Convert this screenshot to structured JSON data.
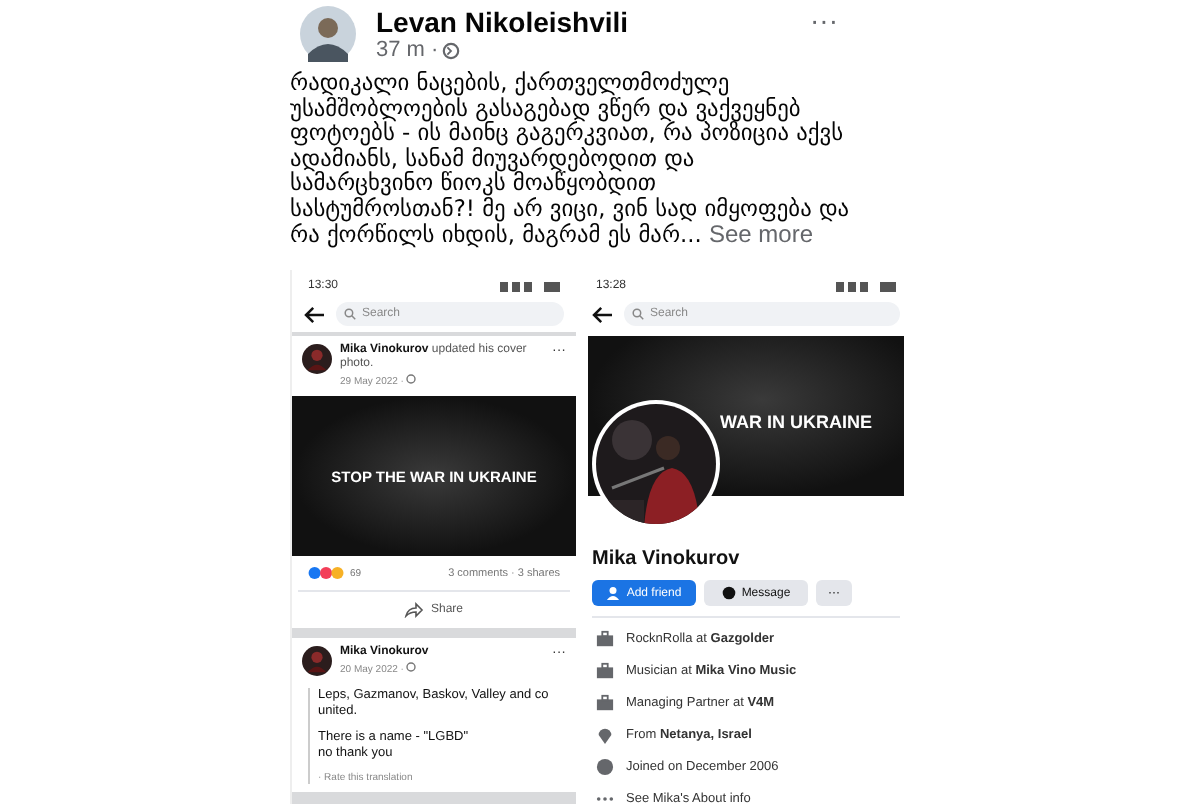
{
  "post": {
    "author": "Levan Nikoleishvili",
    "time": "37 m ·",
    "menu": "···",
    "text": "რადიკალი ნაცების, ქართველთმოძულე უსამშობლოების გასაგებად ვწერ და ვაქვეყნებ ფოტოებს - ის მაინც გაგერკვიათ, რა პოზიცია აქვს ადამიანს, სანამ მიუვარდებოდით და\nსამარცხვინო წიოკს მოაწყობდით\nსასტუმროსთან?! მე არ ვიცი, ვინ სად იმყოფება და რა ქორწილს იხდის, მაგრამ ეს მარ...",
    "see_more": "See more"
  },
  "left_screenshot": {
    "status_time": "13:30",
    "search": {
      "placeholder": "Search"
    },
    "cover_post": {
      "author": "Mika Vinokurov",
      "action": "updated his cover photo.",
      "date": "29 May 2022 ·",
      "menu": "···",
      "banner": "STOP THE WAR IN UKRAINE",
      "reaction_count": "69",
      "stats": "3 comments · 3 shares",
      "share": "Share"
    },
    "text_post": {
      "author": "Mika Vinokurov",
      "date": "20 May 2022 ·",
      "menu": "···",
      "paragraphs": [
        [
          "Leps, Gazmanov, Baskov, Valley and co united."
        ],
        [
          "There is a name - \"LGBD\"",
          "no thank you"
        ]
      ],
      "translate": "· Rate this translation"
    }
  },
  "right_screenshot": {
    "status_time": "13:28",
    "search": {
      "placeholder": "Search"
    },
    "cover_text": "WAR IN UKRAINE",
    "name": "Mika Vinokurov",
    "buttons": [
      {
        "label": "Add friend",
        "kind": "primary"
      },
      {
        "label": "Message",
        "kind": "secondary"
      },
      {
        "label": "···",
        "kind": "more"
      }
    ],
    "details": [
      {
        "kind": "work",
        "text": "RocknRolla at **Gazgolder**"
      },
      {
        "kind": "work",
        "text": "Musician at **Mika Vino Music**"
      },
      {
        "kind": "work",
        "text": "Managing Partner at **V4M**"
      },
      {
        "kind": "location",
        "text": "From **Netanya, Israel**"
      },
      {
        "kind": "joined",
        "text": "Joined on December 2006"
      },
      {
        "kind": "more",
        "text": "See Mika's About info"
      }
    ]
  }
}
